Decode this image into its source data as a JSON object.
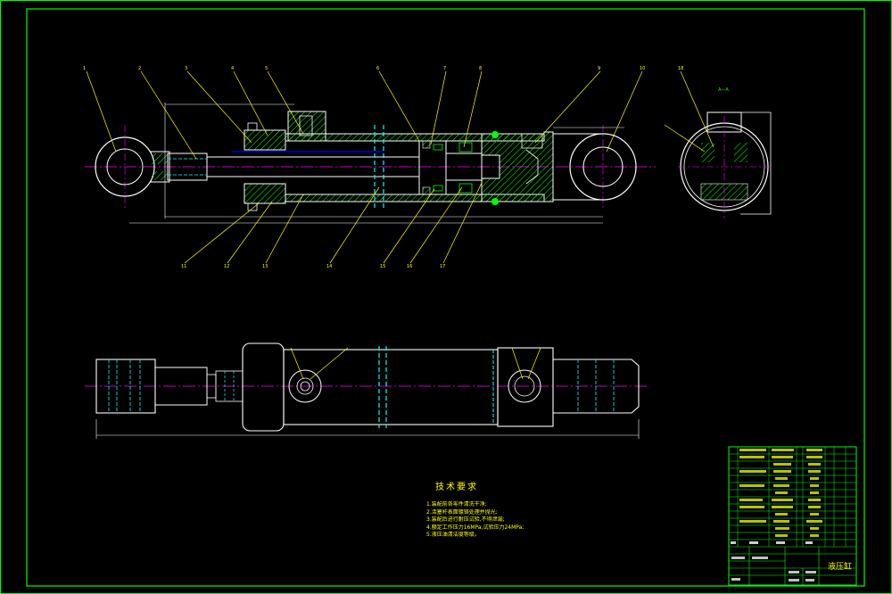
{
  "drawing": {
    "title_block": {
      "name": "液压缸"
    },
    "technical_requirements": {
      "title": "技术要求",
      "notes": [
        "1.装配前各零件清洗干净;",
        "2.活塞杆表面镀铬处理并抛光;",
        "3.装配后进行耐压试验,不得泄漏;",
        "4.额定工作压力16MPa,试验压力24MPa;",
        "5.液压油清洁度等级。"
      ]
    },
    "colors": {
      "background": "#000000",
      "border": "#00ff00",
      "outline": "#ffffff",
      "hatch": "#00ff00",
      "leader": "#ffff00",
      "centerline": "#ff00ff",
      "hidden": "#00ffff",
      "dimension": "#ffffff"
    }
  }
}
